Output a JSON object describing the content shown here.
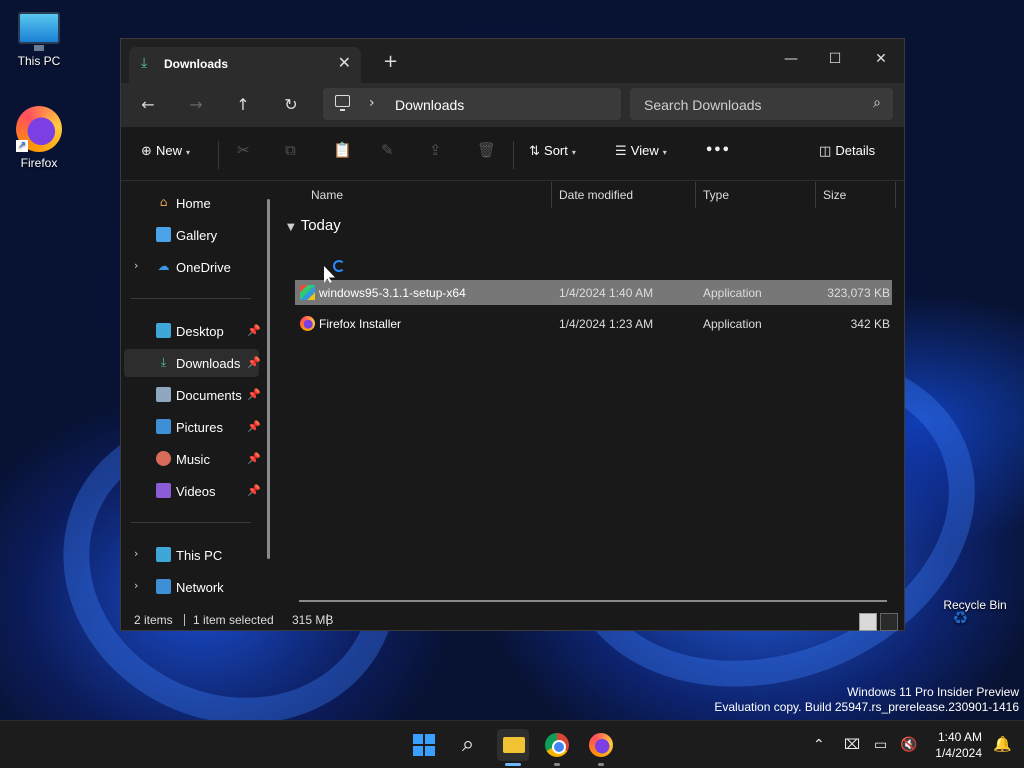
{
  "desktop": {
    "icons": [
      {
        "label": "This PC"
      },
      {
        "label": "Firefox"
      },
      {
        "label": "Recycle Bin"
      }
    ],
    "watermark": {
      "line1": "Windows 11 Pro Insider Preview",
      "line2": "Evaluation copy. Build 25947.rs_prerelease.230901-1416"
    }
  },
  "explorer": {
    "tab_title": "Downloads",
    "address": {
      "crumb": "Downloads"
    },
    "search": {
      "placeholder": "Search Downloads"
    },
    "toolbar": {
      "new_label": "New",
      "sort_label": "Sort",
      "view_label": "View",
      "details_label": "Details"
    },
    "sidebar": {
      "items": [
        {
          "label": "Home",
          "icon": "home-icon"
        },
        {
          "label": "Gallery",
          "icon": "gallery-icon"
        },
        {
          "label": "OneDrive",
          "icon": "cloud-icon"
        },
        {
          "label": "Desktop",
          "icon": "desktop-icon"
        },
        {
          "label": "Downloads",
          "icon": "download-icon"
        },
        {
          "label": "Documents",
          "icon": "document-icon"
        },
        {
          "label": "Pictures",
          "icon": "picture-icon"
        },
        {
          "label": "Music",
          "icon": "music-icon"
        },
        {
          "label": "Videos",
          "icon": "video-icon"
        },
        {
          "label": "This PC",
          "icon": "pc-icon"
        },
        {
          "label": "Network",
          "icon": "network-icon"
        }
      ]
    },
    "columns": {
      "name": "Name",
      "date": "Date modified",
      "type": "Type",
      "size": "Size"
    },
    "group": "Today",
    "files": [
      {
        "name": "windows95-3.1.1-setup-x64",
        "date": "1/4/2024 1:40 AM",
        "type": "Application",
        "size": "323,073 KB"
      },
      {
        "name": "Firefox Installer",
        "date": "1/4/2024 1:23 AM",
        "type": "Application",
        "size": "342 KB"
      }
    ],
    "status": {
      "count": "2 items",
      "selected": "1 item selected",
      "size": "315 MB"
    }
  },
  "taskbar": {
    "clock_time": "1:40 AM",
    "clock_date": "1/4/2024"
  },
  "colors": {
    "accent": "#3aa0ff",
    "selection": "#777777",
    "window_bg": "#191919"
  }
}
